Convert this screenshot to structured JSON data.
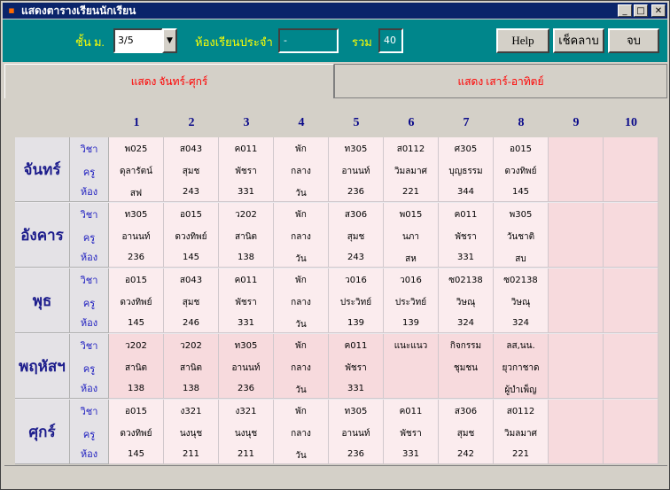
{
  "window": {
    "title": "แสดงตารางเรียนนักเรียน",
    "controls": {
      "minimize": "_",
      "maximize": "□",
      "close": "✕"
    }
  },
  "toolbar": {
    "class_label": "ชั้น ม.",
    "class_value": "3/5",
    "homeroom_label": "ห้องเรียนประจำ",
    "homeroom_value": "-",
    "total_label": "รวม",
    "total_value": "40",
    "help_label": "Help",
    "check_label": "เช็คลาบ",
    "exit_label": "จบ"
  },
  "tabs": [
    {
      "label": "แสดง จันทร์-ศุกร์",
      "active": true
    },
    {
      "label": "แสดง เสาร์-อาทิตย์",
      "active": false
    }
  ],
  "periods": [
    "1",
    "2",
    "3",
    "4",
    "5",
    "6",
    "7",
    "8",
    "9",
    "10"
  ],
  "row_labels": {
    "subject": "วิชา",
    "teacher": "ครู",
    "room": "ห้อง"
  },
  "days": [
    {
      "name": "จันทร์",
      "cells": [
        [
          "พ025",
          "ดุลารัตน์",
          "สฟ"
        ],
        [
          "ส043",
          "สุมช",
          "243"
        ],
        [
          "ค011",
          "พัชรา",
          "331"
        ],
        [
          "พัก",
          "กลาง",
          "วัน"
        ],
        [
          "ท305",
          "อานนท์",
          "236"
        ],
        [
          "ส0112",
          "วิมลมาศ",
          "221"
        ],
        [
          "ศ305",
          "บุญธรรม",
          "344"
        ],
        [
          "อ015",
          "ดวงทิพย์",
          "145"
        ],
        [
          "",
          "",
          ""
        ],
        [
          "",
          "",
          ""
        ]
      ]
    },
    {
      "name": "อังคาร",
      "cells": [
        [
          "ท305",
          "อานนท์",
          "236"
        ],
        [
          "อ015",
          "ดวงทิพย์",
          "145"
        ],
        [
          "ว202",
          "สานิต",
          "138"
        ],
        [
          "พัก",
          "กลาง",
          "วัน"
        ],
        [
          "ส306",
          "สุมช",
          "243"
        ],
        [
          "พ015",
          "นภา",
          "สห"
        ],
        [
          "ค011",
          "พัชรา",
          "331"
        ],
        [
          "พ305",
          "วันชาติ",
          "สบ"
        ],
        [
          "",
          "",
          ""
        ],
        [
          "",
          "",
          ""
        ]
      ]
    },
    {
      "name": "พุธ",
      "cells": [
        [
          "อ015",
          "ดวงทิพย์",
          "145"
        ],
        [
          "ส043",
          "สุมช",
          "246"
        ],
        [
          "ค011",
          "พัชรา",
          "331"
        ],
        [
          "พัก",
          "กลาง",
          "วัน"
        ],
        [
          "ว016",
          "ประวิทย์",
          "139"
        ],
        [
          "ว016",
          "ประวิทย์",
          "139"
        ],
        [
          "ซ02138",
          "วิษณุ",
          "324"
        ],
        [
          "ซ02138",
          "วิษณุ",
          "324"
        ],
        [
          "",
          "",
          ""
        ],
        [
          "",
          "",
          ""
        ]
      ]
    },
    {
      "name": "พฤหัสฯ",
      "cells": [
        [
          "ว202",
          "สานิต",
          "138"
        ],
        [
          "ว202",
          "สานิต",
          "138"
        ],
        [
          "ท305",
          "อานนท์",
          "236"
        ],
        [
          "พัก",
          "กลาง",
          "วัน"
        ],
        [
          "ค011",
          "พัชรา",
          "331"
        ],
        [
          "แนะแนว",
          "",
          ""
        ],
        [
          "กิจกรรม",
          "ชุมชน",
          ""
        ],
        [
          "ลส,นน.",
          "ยุวกาชาด",
          "ผู้บำเพ็ญ"
        ],
        [
          "",
          "",
          ""
        ],
        [
          "",
          "",
          ""
        ]
      ]
    },
    {
      "name": "ศุกร์",
      "cells": [
        [
          "อ015",
          "ดวงทิพย์",
          "145"
        ],
        [
          "ง321",
          "นงนุช",
          "211"
        ],
        [
          "ง321",
          "นงนุช",
          "211"
        ],
        [
          "พัก",
          "กลาง",
          "วัน"
        ],
        [
          "ท305",
          "อานนท์",
          "236"
        ],
        [
          "ค011",
          "พัชรา",
          "331"
        ],
        [
          "ส306",
          "สุมช",
          "242"
        ],
        [
          "ส0112",
          "วิมลมาศ",
          "221"
        ],
        [
          "",
          "",
          ""
        ],
        [
          "",
          "",
          ""
        ]
      ]
    }
  ],
  "colors": {
    "titlebar": "#0a246a",
    "toolbar": "#00868b",
    "label_yellow": "#ffff00",
    "tab_text": "#ff0000",
    "day_text": "#1c1c8c",
    "cell_light": "#fbecee",
    "cell_pink": "#f7dadd"
  }
}
